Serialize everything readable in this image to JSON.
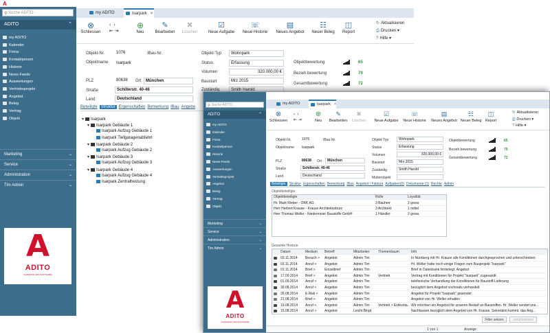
{
  "colors": {
    "sidebar": "#3c6d8b",
    "accent": "#2a7ab4",
    "brand": "#d0112b",
    "rating": "#2a9a3a"
  },
  "back": {
    "search_placeholder": "Suche ADITO",
    "section": "ADITO",
    "nav": [
      "my ADITO",
      "Kalender",
      "Firma",
      "Kontaktperson",
      "Historie",
      "News-Feeds",
      "Auswertungen",
      "Vertriebsprojekt",
      "Angebot",
      "Beleg",
      "Vertrag",
      "Objekt"
    ],
    "categories": [
      "Marketing",
      "Service",
      "Administration",
      "Tim Admin"
    ],
    "logo": {
      "word": "ADITO",
      "tag": "SUPERIOR CRM SOFTWARE"
    },
    "tabs": {
      "home": "my ADITO",
      "active": "Isarpark"
    },
    "toolbar": {
      "close": "Schliessen",
      "new": "Neu",
      "edit": "Bearbeiten",
      "delete": "Löschen",
      "new_task": "Neue Aufgabe",
      "new_history": "Neue Historie",
      "new_offer": "Neues Angebot",
      "new_doc": "Neuer Beleg",
      "report": "Report",
      "refresh": "Aktualisieren",
      "print": "Drucken",
      "help": "Hilfe"
    },
    "form": {
      "objnr_l": "Objekt-Nr.",
      "objnr": "1076",
      "ibau_l": "IBau-Nr.",
      "name_l": "Objektname",
      "name": "Isarpark",
      "plz_l": "PLZ",
      "plz": "80638",
      "ort_l": "Ort",
      "ort": "München",
      "str_l": "Straße",
      "str": "Schillerstr. 40-46",
      "land_l": "Land",
      "land": "Deutschland",
      "typ_l": "Objekt-Typ",
      "typ": "Wohnpark",
      "status_l": "Status",
      "status": "Erfassung",
      "vol_l": "Volumen",
      "vol": "320.000,00 €",
      "start_l": "Baustart",
      "start": "Mrz 2015",
      "zust_l": "Zuständig",
      "zust": "Smith Harold"
    },
    "ratings": [
      {
        "label": "Objektbewertung",
        "value": "65"
      },
      {
        "label": "Bezieh.bewertung",
        "value": "79"
      },
      {
        "label": "Gesamtbewertung",
        "value": "72"
      }
    ],
    "ftabs": [
      "Beteiligte",
      "Struktur",
      "Ergenschaften",
      "Bemerkung",
      "IBau",
      "Angebo"
    ],
    "tree": [
      {
        "t": "Isarpark",
        "lvl": 0,
        "kind": "f"
      },
      {
        "t": "Isarpark Gebäude 1",
        "lvl": 1,
        "kind": "f"
      },
      {
        "t": "Isarpark Aufzug Gebäude 1",
        "lvl": 2,
        "kind": "c"
      },
      {
        "t": "Isarpark Tiefgaragenabfahrt",
        "lvl": 2,
        "kind": "c"
      },
      {
        "t": "Isarpark Gebäude 2",
        "lvl": 1,
        "kind": "f"
      },
      {
        "t": "Isarpark Aufzug Gebäude 2",
        "lvl": 2,
        "kind": "c"
      },
      {
        "t": "Isarpark Gebäude 3",
        "lvl": 1,
        "kind": "f"
      },
      {
        "t": "Isarpark Aufzug Gebäude 3",
        "lvl": 2,
        "kind": "c"
      },
      {
        "t": "Isarpark Gebäude 4",
        "lvl": 1,
        "kind": "f"
      },
      {
        "t": "Isarpark Aufzug Gebäude 4",
        "lvl": 2,
        "kind": "c"
      },
      {
        "t": "Isarpark Zentralheizung",
        "lvl": 2,
        "kind": "c"
      }
    ]
  },
  "front": {
    "search_placeholder": "Suche ADITO",
    "section": "ADITO",
    "nav": [
      "my ADITO",
      "Kalender",
      "Firma",
      "Kontaktperson",
      "Historie",
      "News-Feeds",
      "Auswertungen",
      "Vertriebsprojekt",
      "Angebot",
      "Beleg",
      "Vertrag",
      "Objekt"
    ],
    "categories": [
      "Marketing",
      "Service",
      "Administration",
      "Tim Admin"
    ],
    "logo": {
      "word": "ADITO",
      "tag": "SUPERIOR CRM SOFTWARE"
    },
    "tabs": {
      "home": "my ADITO",
      "active": "Isarpark"
    },
    "toolbar": {
      "close": "Schliessen",
      "new": "Neu",
      "edit": "Bearbeiten",
      "delete": "Löschen",
      "new_task": "Neue Aufgabe",
      "new_history": "Neue Historie",
      "new_offer": "Neues Angebot",
      "new_doc": "Neuer Beleg",
      "report": "Report",
      "refresh": "Aktualisieren",
      "print": "Drucken",
      "help": "Hilfe"
    },
    "form": {
      "objnr_l": "Objekt-Nr.",
      "objnr": "1076",
      "ibau_l": "IBau-Nr.",
      "name_l": "Objektname",
      "name": "Isarpark",
      "plz_l": "PLZ",
      "plz": "80638",
      "ort_l": "Ort",
      "ort": "München",
      "str_l": "Straße",
      "str": "Schillerstr. 40-46",
      "land_l": "Land",
      "land": "Deutschland",
      "typ_l": "Objekt-Typ",
      "typ": "Wohnpark",
      "status_l": "Status",
      "status": "Erfassung",
      "vol_l": "Volumen",
      "vol": "320.000,00 €",
      "start_l": "Baustart",
      "start": "Mrz 2015",
      "zust_l": "Zuständig",
      "zust": "Smith Harold",
      "mutter_l": "Mutterobjekt"
    },
    "ratings": [
      {
        "label": "Objektbewertung",
        "value": "65"
      },
      {
        "label": "Bezieh.bewertung",
        "value": "79"
      },
      {
        "label": "Gesamtbewertung",
        "value": "72"
      }
    ],
    "ftabs": [
      "Beteiligte",
      "Struktur",
      "Eigenschaften",
      "Bemerkung",
      "IBau",
      "Angebot / Faktura",
      "Aufgaben(0)",
      "Dokumente (1)",
      "Rechte",
      "Admin"
    ],
    "beteiligte": {
      "title": "Objektbeteiligte",
      "cols": [
        "Objektbeteiligte",
        "Rolle",
        "Loyalität"
      ],
      "rows": [
        [
          "Hr. Mark Rieber - ORK AG",
          "3 Bauherr",
          "2 gross"
        ],
        [
          "Herr Herbert Krause - Krause Architekturbüro",
          "3 Architekt",
          "1 mittel"
        ],
        [
          "Herr Thomas Weller - Niedermeier Baustoffe GmbH",
          "1 Händler",
          "2 gross"
        ]
      ]
    },
    "historie": {
      "title": "Gesamte Historie",
      "cols": [
        "",
        "Datum",
        "Medium",
        "Betreff",
        "Mitarbeiter",
        "Themenbaum",
        "Info"
      ],
      "rows": [
        [
          "03.11.2014",
          "Besuch >",
          "Angebot",
          "Admin Tim",
          "",
          "In Nürnberg mit Hr. Krause alle Konditionen durchgesprochen und unterschrieben"
        ],
        [
          "03.11.2014",
          "Anruf >",
          "Angebot",
          "Admin Tim",
          "",
          "Hr. Weller hatte noch einige Fragen zum Bauprojekt \"Isarpark\""
        ],
        [
          "01.11.2014",
          "Brief >",
          "Einzelbrief",
          "Admin Tim",
          "",
          "Brief in Datenbank hinterlegt: Angebot"
        ],
        [
          "17.09.2014",
          "Brief >",
          "Angebot",
          "Admin Tim",
          "Vertrieb",
          "Vertrag mit Konditionen für Projekt \"Isarpark\" zugesandt"
        ],
        [
          "01.09.2014",
          "Anruf >",
          "Angebot",
          "Admin Tim",
          "",
          "telefonische Verhandlung der Konditionen für Baustoff-Lieferung"
        ],
        [
          "30.08.2014",
          "Anruf <",
          "Angebot",
          "Admin Tim",
          "",
          "bezüglich dem Angebot nochmals verhandelt"
        ],
        [
          "26.08.2014",
          "E-Mail >",
          "Angebot",
          "Admin Tim",
          "",
          "Angebot für Projekt \"Isarpark\" gesendet"
        ],
        [
          "21.08.2014",
          "Brief >",
          "Angebot",
          "Admin Tim",
          "",
          "Angebot von Hr. Weller erhalten"
        ],
        [
          "19.08.2014",
          "Anruf <",
          "Angebot",
          "Admin Tim",
          "Vertrieb > Entkonta...",
          "Wir möchten ein Angebot für unseren Bedarf an Baustoffen. Hr. Weller sendet uns..."
        ],
        [
          "15.08.2014",
          "Anruf >",
          "Angebot",
          "Leicht Birgit",
          "",
          "Nachfassen bezüglich dem Angebot von Hr. Krause. Sekretärin kommt. das Ang..."
        ]
      ],
      "filter_btn": "Filter setzen",
      "reset_btn": "zurücksetzen"
    },
    "footer": {
      "pager": "1 von 1",
      "view_label": "Anzeige"
    }
  }
}
